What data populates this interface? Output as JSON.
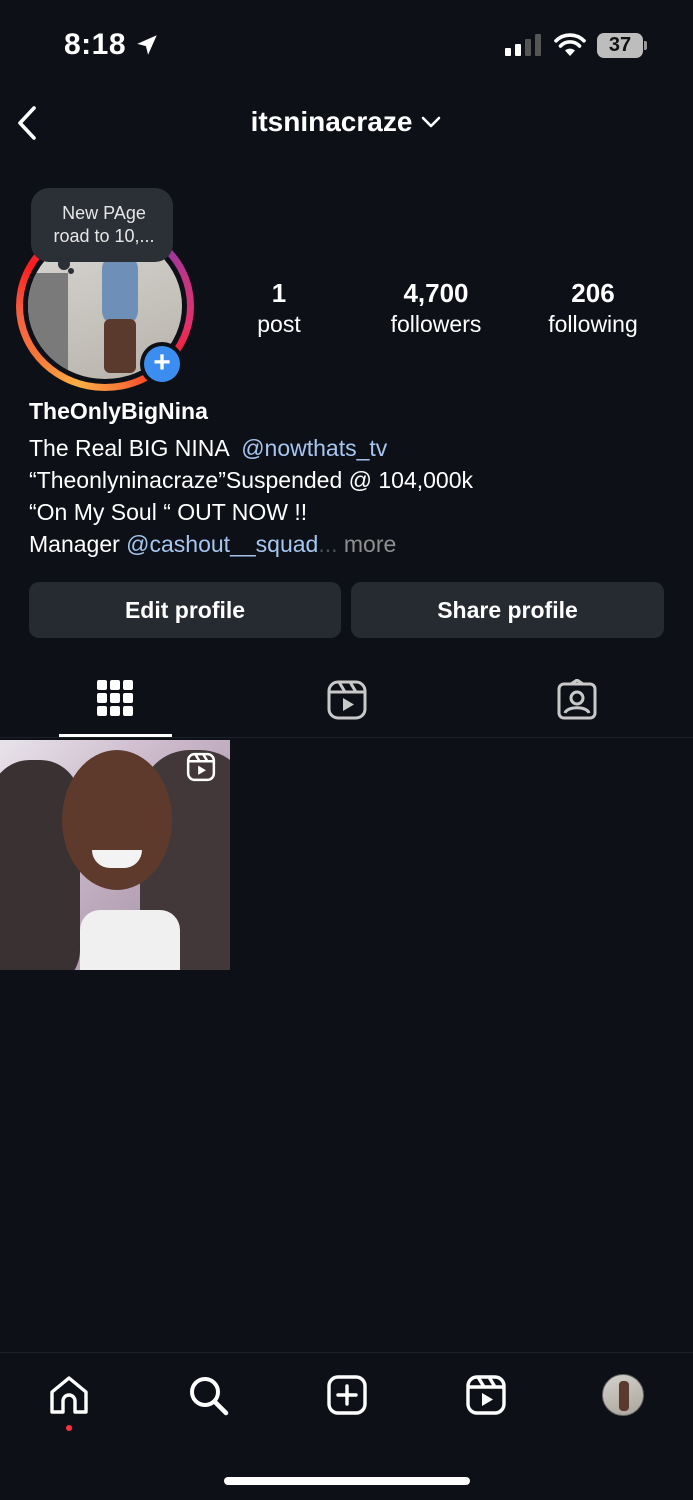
{
  "status_bar": {
    "time": "8:18",
    "battery": "37"
  },
  "header": {
    "username": "itsninacraze"
  },
  "note": {
    "text_line1": "New PAge",
    "text_line2": "road to 10,..."
  },
  "stats": {
    "posts_count": "1",
    "posts_label": "post",
    "followers_count": "4,700",
    "followers_label": "followers",
    "following_count": "206",
    "following_label": "following"
  },
  "profile": {
    "display_name": "TheOnlyBigNina",
    "bio_line1_text": "The Real BIG NINA  ",
    "bio_line1_mention": "@nowthats_tv",
    "bio_line2": "“Theonlyninacraze”Suspended @ 104,000k",
    "bio_line3": "“On My Soul “ OUT NOW !!",
    "bio_line4_text": "Manager ",
    "bio_line4_mention": "@cashout__squad",
    "bio_more_ellipsis": "...",
    "bio_more": " more"
  },
  "actions": {
    "edit_label": "Edit profile",
    "share_label": "Share profile"
  },
  "tabs": [
    {
      "name": "grid-icon",
      "active": true
    },
    {
      "name": "reels-icon",
      "active": false
    },
    {
      "name": "tagged-icon",
      "active": false
    }
  ],
  "posts": [
    {
      "type": "reel"
    }
  ],
  "bottom_nav": [
    "home-icon",
    "search-icon",
    "create-icon",
    "reels-icon",
    "profile-avatar"
  ],
  "colors": {
    "background": "#0d1117",
    "button": "#262a31",
    "link": "#a6c6f1",
    "accent_blue": "#3b8ef0",
    "notification_dot": "#ff3040"
  }
}
